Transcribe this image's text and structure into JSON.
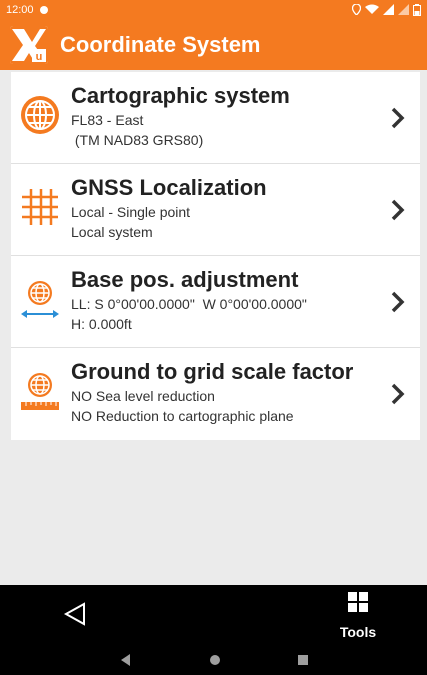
{
  "status_bar": {
    "time": "12:00",
    "icons": [
      "location-icon",
      "wifi-icon",
      "signal-icon",
      "battery-icon"
    ]
  },
  "app_bar": {
    "title": "Coordinate System",
    "logo": "xu-logo"
  },
  "items": [
    {
      "title": "Cartographic system",
      "line1": "FL83 - East",
      "line2": " (TM NAD83 GRS80)",
      "icon": "globe-icon"
    },
    {
      "title": "GNSS Localization",
      "line1": "Local - Single point",
      "line2": "Local system",
      "icon": "grid-icon"
    },
    {
      "title": "Base pos. adjustment",
      "line1": "LL: S 0°00'00.0000\"  W 0°00'00.0000\"",
      "line2": "H: 0.000ft",
      "icon": "globe-arrows-icon"
    },
    {
      "title": "Ground to grid scale factor",
      "line1": "NO Sea level reduction",
      "line2": "NO Reduction to cartographic plane",
      "icon": "globe-ruler-icon"
    }
  ],
  "bottom_bar": {
    "tools_label": "Tools"
  },
  "colors": {
    "accent": "#f47a20",
    "background": "#ebebeb",
    "bar": "#000000"
  }
}
